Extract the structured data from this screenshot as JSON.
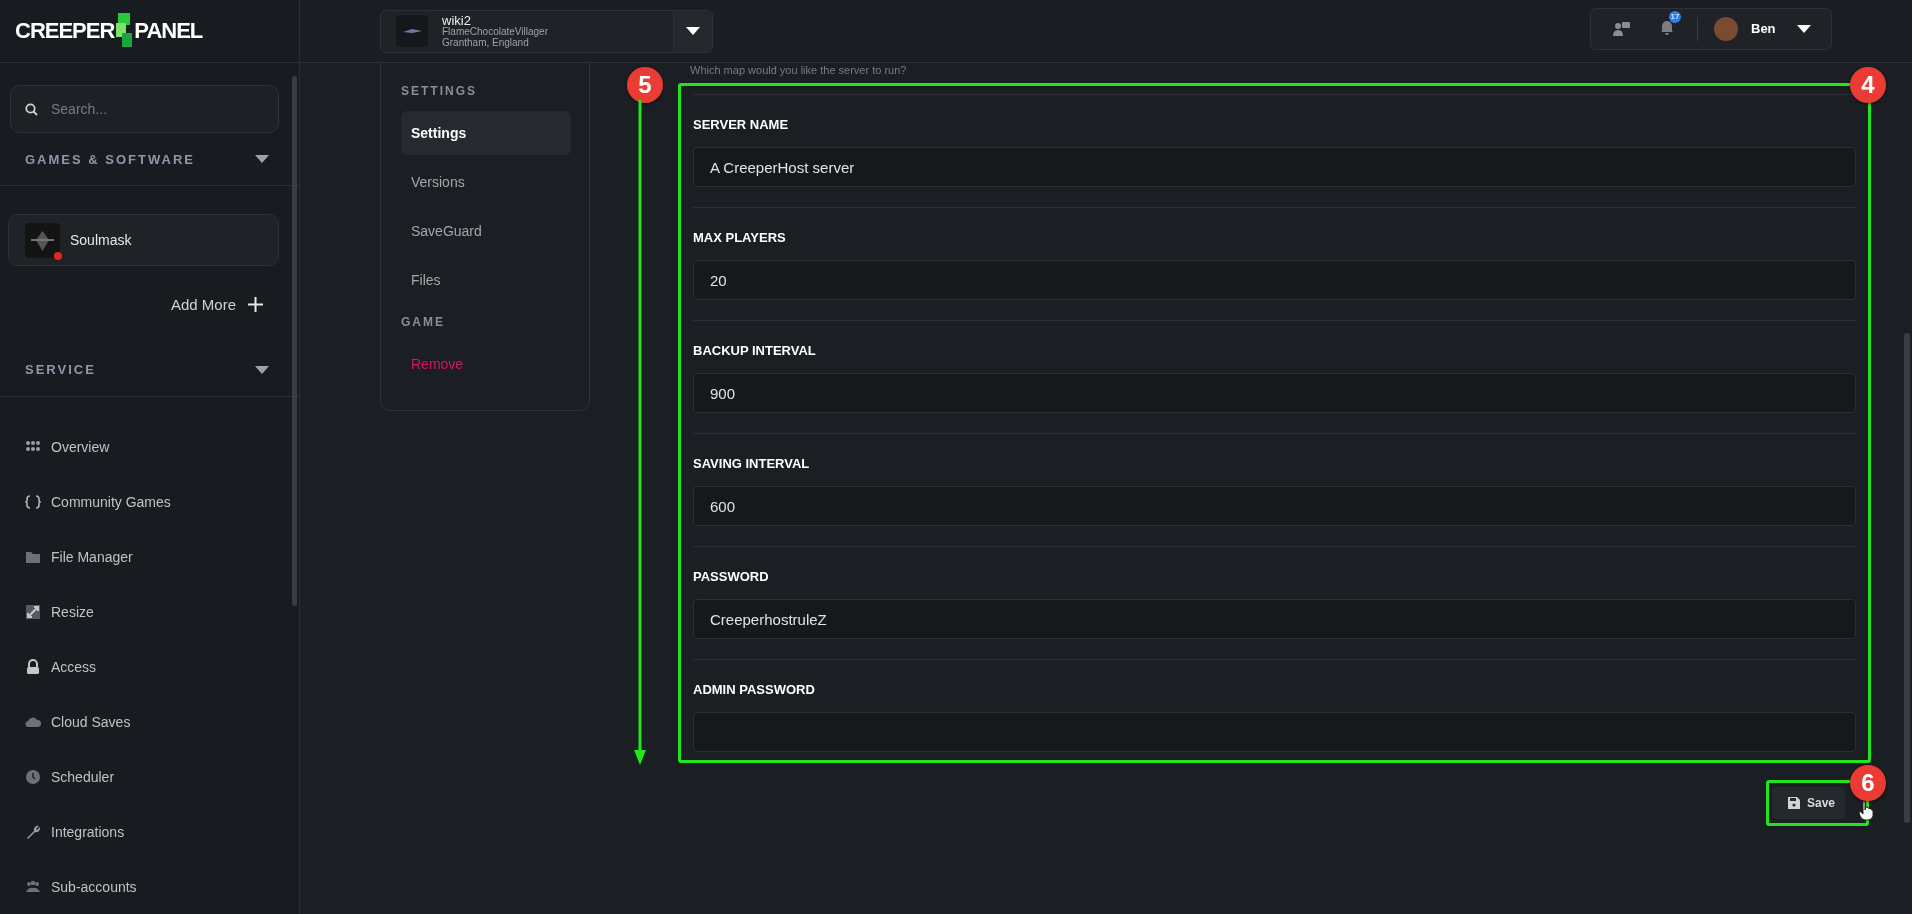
{
  "logo": {
    "left": "CREEPER",
    "right": "PANEL"
  },
  "sidebar": {
    "search": {
      "placeholder": "Search..."
    },
    "games_header": {
      "label": "GAMES & SOFTWARE",
      "expanded": true
    },
    "servers": [
      {
        "name": "Soulmask",
        "color": "#e8271b"
      }
    ],
    "add_more": "Add More",
    "service_header": {
      "label": "SERVICE",
      "expanded": true
    },
    "nav": [
      "Overview",
      "Community Games",
      "File Manager",
      "Resize",
      "Access",
      "Cloud Saves",
      "Scheduler",
      "Integrations",
      "Sub-accounts"
    ]
  },
  "topbar": {
    "server": {
      "name": "wiki2",
      "owner": "FlameChocolateVillager",
      "location": "Grantham, England"
    },
    "notifications": "17",
    "user": "Ben"
  },
  "settings_menu": [
    {
      "heading": "SETTINGS",
      "items": [
        {
          "label": "Settings",
          "selected": true,
          "kind": "link"
        },
        {
          "label": "Versions",
          "selected": false,
          "kind": "link"
        },
        {
          "label": "SaveGuard",
          "selected": false,
          "kind": "link"
        },
        {
          "label": "Files",
          "selected": false,
          "kind": "link"
        }
      ]
    },
    {
      "heading": "GAME",
      "items": [
        {
          "label": "Remove",
          "selected": false,
          "kind": "danger"
        }
      ]
    }
  ],
  "form": {
    "hint": "Which map would you like the server to run?",
    "fields": [
      {
        "label": "SERVER NAME",
        "value": "A CreeperHost server"
      },
      {
        "label": "MAX PLAYERS",
        "value": "20"
      },
      {
        "label": "BACKUP INTERVAL",
        "value": "900"
      },
      {
        "label": "SAVING INTERVAL",
        "value": "600"
      },
      {
        "label": "PASSWORD",
        "value": "CreeperhostruleZ"
      },
      {
        "label": "ADMIN PASSWORD"
      }
    ],
    "save": "Save"
  },
  "annotations": [
    "4",
    "5",
    "6"
  ]
}
